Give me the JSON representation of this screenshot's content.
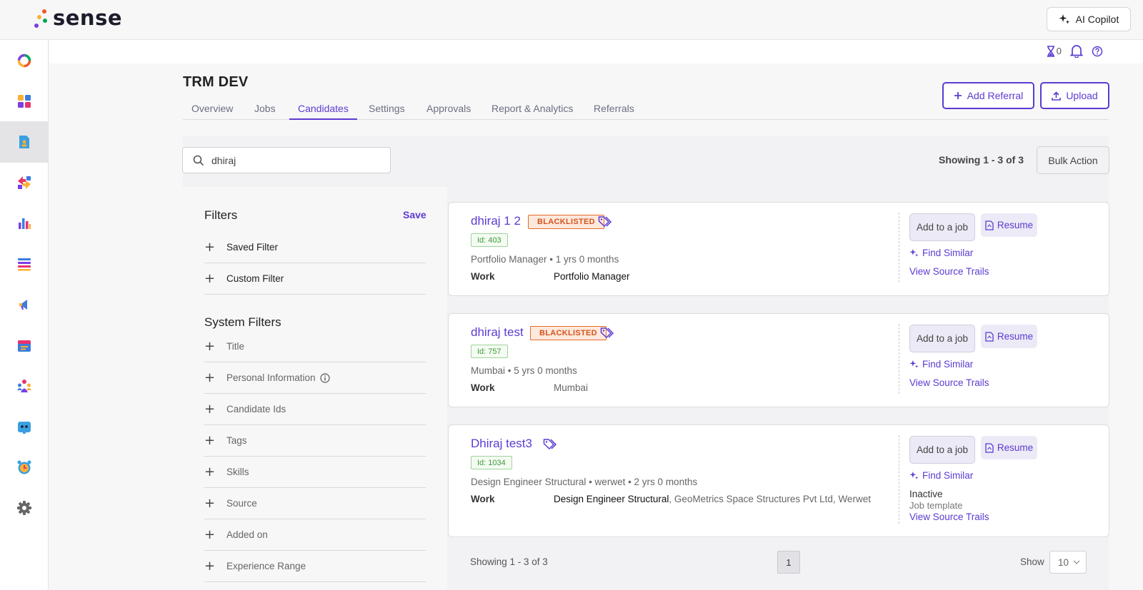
{
  "brand": {
    "name": "sense"
  },
  "topbar": {
    "copilot_label": "AI Copilot"
  },
  "sidebar": {
    "items": [
      {
        "icon": "ring-logo-icon"
      },
      {
        "icon": "dashboard-icon"
      },
      {
        "icon": "candidate-doc-icon",
        "active": true
      },
      {
        "icon": "sync-arrows-icon"
      },
      {
        "icon": "bar-chart-icon"
      },
      {
        "icon": "list-icon"
      },
      {
        "icon": "megaphone-icon"
      },
      {
        "icon": "calendar-icon"
      },
      {
        "icon": "team-icon"
      },
      {
        "icon": "bot-icon"
      },
      {
        "icon": "alarm-clock-icon"
      },
      {
        "icon": "gear-icon"
      }
    ]
  },
  "util": {
    "hourglass_count": "0"
  },
  "page": {
    "title": "TRM DEV"
  },
  "tabs": [
    {
      "label": "Overview"
    },
    {
      "label": "Jobs"
    },
    {
      "label": "Candidates",
      "active": true
    },
    {
      "label": "Settings"
    },
    {
      "label": "Approvals"
    },
    {
      "label": "Report & Analytics"
    },
    {
      "label": "Referrals"
    }
  ],
  "header_buttons": {
    "add_referral": "Add Referral",
    "upload": "Upload"
  },
  "search": {
    "value": "dhiraj",
    "placeholder": "Search"
  },
  "results": {
    "showing": "Showing 1 - 3 of 3",
    "bulk_action": "Bulk Action"
  },
  "filters": {
    "title": "Filters",
    "save": "Save",
    "saved_filter": "Saved Filter",
    "custom_filter": "Custom Filter",
    "system_title": "System Filters",
    "system": [
      "Title",
      "Personal Information",
      "Candidate Ids",
      "Tags",
      "Skills",
      "Source",
      "Added on",
      "Experience Range"
    ]
  },
  "candidates": [
    {
      "name": "dhiraj 1 2",
      "badge": "BLACKLISTED",
      "id": "Id: 403",
      "meta": "Portfolio Manager • 1 yrs 0 months",
      "work_label": "Work",
      "work_strong": "Portfolio Manager",
      "work_rest": ""
    },
    {
      "name": "dhiraj test",
      "badge": "BLACKLISTED",
      "id": "Id: 757",
      "meta": "Mumbai • 5 yrs 0 months",
      "work_label": "Work",
      "work_strong": "",
      "work_rest": "Mumbai"
    },
    {
      "name": "Dhiraj test3",
      "badge": "",
      "id": "Id: 1034",
      "meta": "Design Engineer Structural • werwet • 2 yrs 0 months",
      "work_label": "Work",
      "work_strong": "Design Engineer Structural",
      "work_rest": ", GeoMetrics Space Structures Pvt Ltd, Werwet",
      "status": "Inactive",
      "template": "Job template"
    }
  ],
  "card_actions": {
    "add_to_job": "Add to a job",
    "resume": "Resume",
    "find_similar": "Find Similar",
    "view_source_trails": "View Source Trails"
  },
  "pagination": {
    "showing": "Showing 1 - 3 of 3",
    "page": "1",
    "show_label": "Show",
    "page_size": "10"
  },
  "colors": {
    "accent": "#5c3bd1",
    "blacklist": "#d4541b",
    "id_green": "#3c9b33"
  }
}
